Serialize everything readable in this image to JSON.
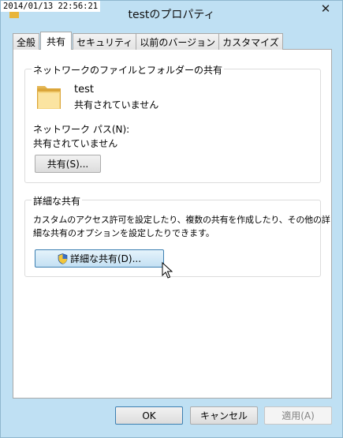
{
  "window": {
    "title": "testのプロパティ",
    "timestamp": "2014/01/13 22:56:21",
    "close_glyph": "✕"
  },
  "tabs": [
    {
      "label": "全般"
    },
    {
      "label": "共有",
      "active": true
    },
    {
      "label": "セキュリティ"
    },
    {
      "label": "以前のバージョン"
    },
    {
      "label": "カスタマイズ"
    }
  ],
  "network_sharing": {
    "title": "ネットワークのファイルとフォルダーの共有",
    "folder_name": "test",
    "folder_status": "共有されていません",
    "path_label": "ネットワーク パス(N):",
    "path_value": "共有されていません",
    "share_button": "共有(S)..."
  },
  "advanced_sharing": {
    "title": "詳細な共有",
    "description_line1": "カスタムのアクセス許可を設定したり、複数の共有を作成したり、その他の詳",
    "description_line2": "細な共有のオプションを設定したりできます。",
    "button": "詳細な共有(D)..."
  },
  "footer": {
    "ok": "OK",
    "cancel": "キャンセル",
    "apply": "適用(A)"
  },
  "icons": {
    "folder": "folder-icon",
    "shield": "uac-shield-icon",
    "close": "close-icon",
    "cursor": "mouse-cursor-icon"
  }
}
